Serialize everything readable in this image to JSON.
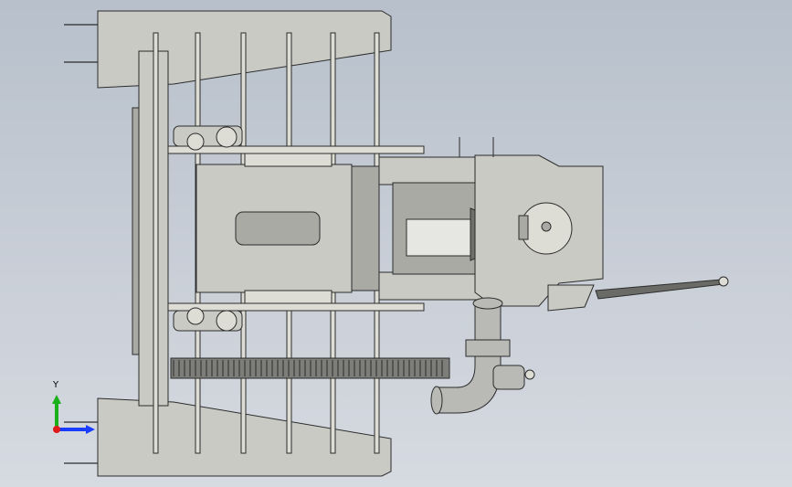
{
  "viewport": {
    "background_top": "#b7c0cb",
    "background_bottom": "#d6dae1"
  },
  "model": {
    "part_fill": "#c9cac3",
    "part_fill_dark": "#a9aaa3",
    "part_fill_light": "#dddcd5",
    "edge_color": "#2c2c2c",
    "tine_count": 6,
    "pipe_color": "#b9bab6"
  },
  "triad": {
    "y_label": "Y",
    "x_color": "#1a3cff",
    "y_color": "#19b019",
    "z_color": "#e01a1a"
  }
}
